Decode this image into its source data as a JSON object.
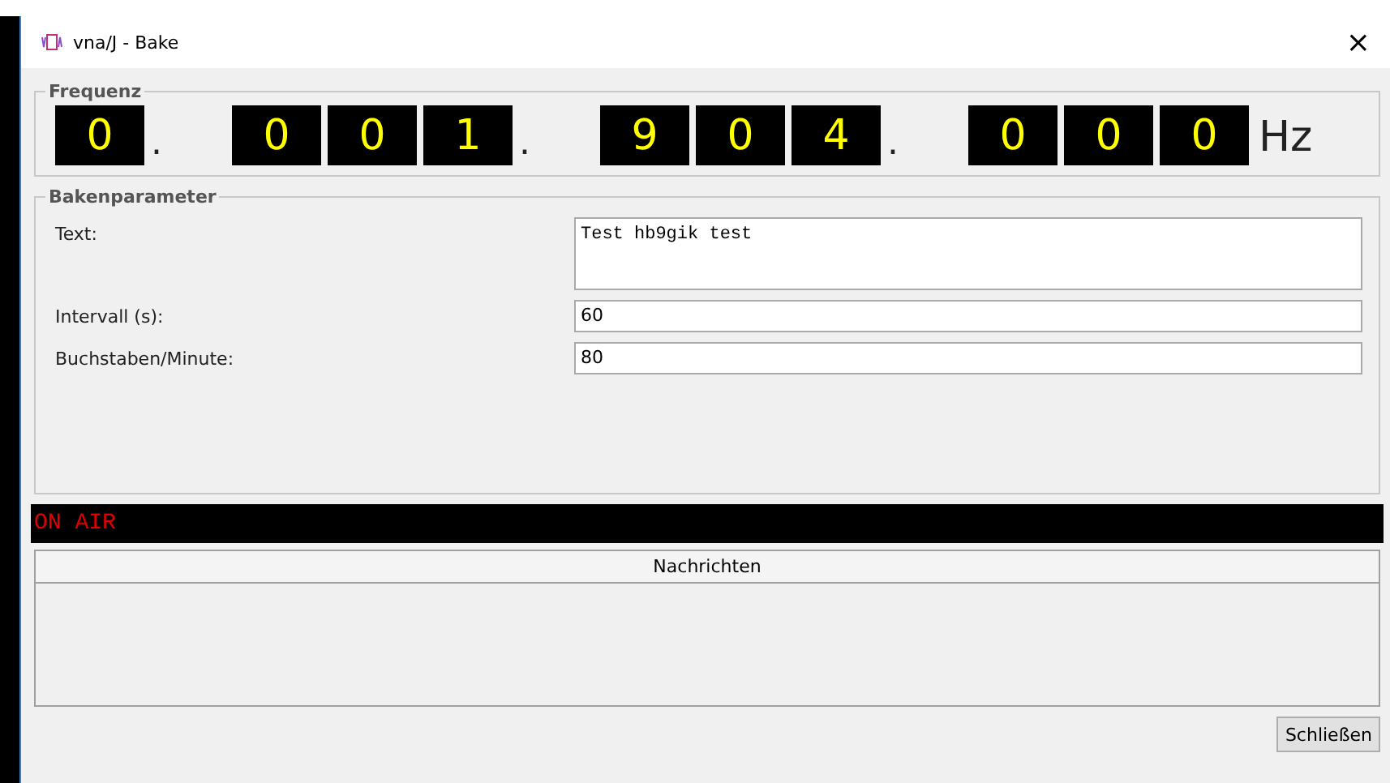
{
  "window": {
    "title": "vna/J - Bake",
    "close": "×"
  },
  "frequency": {
    "title": "Frequenz",
    "unit": "Hz",
    "digits": [
      {
        "kind": "digit",
        "text": "0"
      },
      {
        "kind": "separator",
        "text": "."
      },
      {
        "kind": "digit",
        "text": "0"
      },
      {
        "kind": "digit",
        "text": "0"
      },
      {
        "kind": "digit",
        "text": "1"
      },
      {
        "kind": "separator",
        "text": "."
      },
      {
        "kind": "digit",
        "text": "9"
      },
      {
        "kind": "digit",
        "text": "0"
      },
      {
        "kind": "digit",
        "text": "4"
      },
      {
        "kind": "separator",
        "text": "."
      },
      {
        "kind": "digit",
        "text": "0"
      },
      {
        "kind": "digit",
        "text": "0"
      },
      {
        "kind": "digit",
        "text": "0"
      }
    ]
  },
  "parameters": {
    "title": "Bakenparameter",
    "fields": [
      {
        "kind": "textarea",
        "label": "Text:",
        "value": "Test hb9gik test"
      },
      {
        "kind": "input",
        "label": "Intervall (s):",
        "value": "60"
      },
      {
        "kind": "input",
        "label": "Buchstaben/Minute:",
        "value": "80"
      }
    ]
  },
  "status": {
    "text": "ON AIR"
  },
  "messages": {
    "columns": [
      "Nachrichten"
    ]
  },
  "buttons": [
    "Schließen"
  ]
}
